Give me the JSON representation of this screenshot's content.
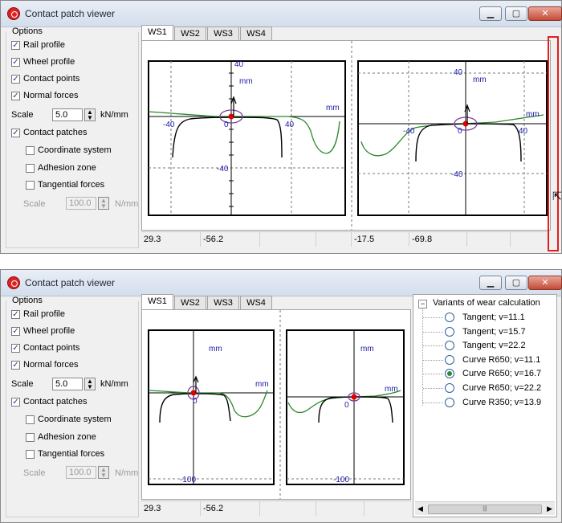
{
  "window": {
    "title": "Contact patch viewer",
    "min": "▁",
    "max": "▢",
    "close": "✕"
  },
  "options": {
    "legend": "Options",
    "rail_profile": "Rail profile",
    "wheel_profile": "Wheel profile",
    "contact_points": "Contact points",
    "normal_forces": "Normal forces",
    "scale_label": "Scale",
    "scale_value": "5.0",
    "scale_unit": "kN/mm",
    "contact_patches": "Contact patches",
    "coordinate_system": "Coordinate system",
    "adhesion_zone": "Adhesion zone",
    "tangential_forces": "Tangential forces",
    "tscale_label": "Scale",
    "tscale_value": "100.0",
    "tscale_unit": "N/mm"
  },
  "tabs": [
    "WS1",
    "WS2",
    "WS3",
    "WS4"
  ],
  "top": {
    "left_plot": {
      "unit_y": "mm",
      "unit_x": "mm",
      "y_top": "40",
      "y_bottom": "-40",
      "x_left": "-40",
      "x_right": "40",
      "origin": "0"
    },
    "right_plot": {
      "unit_y": "mm",
      "unit_x": "mm",
      "y_top": "40",
      "y_bottom": "-40",
      "x_left": "-40",
      "x_right": "40",
      "origin": "0"
    },
    "status": [
      "29.3",
      "-56.2",
      "-17.5",
      "-69.8"
    ]
  },
  "bottom": {
    "left_plot": {
      "unit_y": "mm",
      "unit_x": "mm",
      "y_bottom": "-100",
      "origin": "0"
    },
    "right_plot": {
      "unit_y": "mm",
      "unit_x": "mm",
      "y_bottom": "-100",
      "origin": "0"
    },
    "status": [
      "29.3",
      "-56.2"
    ],
    "tree": {
      "root": "Variants of wear calculation",
      "items": [
        {
          "label": "Tangent; v=11.1",
          "selected": false
        },
        {
          "label": "Tangent; v=15.7",
          "selected": false
        },
        {
          "label": "Tangent; v=22.2",
          "selected": false
        },
        {
          "label": "Curve R650; v=11.1",
          "selected": false
        },
        {
          "label": "Curve R650; v=16.7",
          "selected": true
        },
        {
          "label": "Curve R650; v=22.2",
          "selected": false
        },
        {
          "label": "Curve R350; v=13.9",
          "selected": false
        }
      ]
    }
  },
  "colors": {
    "rail": "#2a8a2a",
    "wheel": "#000000",
    "contact_point": "#e00000",
    "patch": "#7a3e9a",
    "axis_label": "#1a1aa6"
  }
}
